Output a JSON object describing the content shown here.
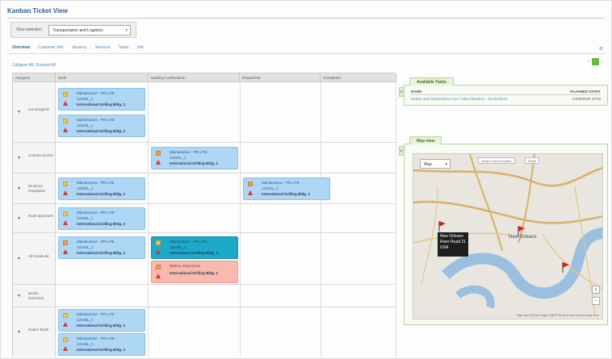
{
  "app": {
    "title": "Kanban Ticket View"
  },
  "view_selector": {
    "label": "View selection",
    "value": "Transportation and Logistics"
  },
  "tabs": [
    {
      "label": "Overview",
      "active": true
    },
    {
      "label": "Customer Info",
      "active": false
    },
    {
      "label": "Vacancy",
      "active": false
    },
    {
      "label": "Services",
      "active": false
    },
    {
      "label": "Tasks",
      "active": false
    },
    {
      "label": "Info",
      "active": false
    }
  ],
  "collapse_link": "Collapse All | Expand All",
  "columns": [
    "Assignee",
    "Work",
    "Awaiting Confirmation",
    "Dispatched",
    "Completed"
  ],
  "rows": [
    {
      "label": "not assigned"
    },
    {
      "label": "Corinna Hinrich"
    },
    {
      "label": "Dimitrios Papadakis"
    },
    {
      "label": "Noah Baumann"
    },
    {
      "label": "Ali Karabulut"
    },
    {
      "label": "Benito Dazzardo"
    },
    {
      "label": "Ruben Barth"
    }
  ],
  "card_text": {
    "line1": "Maintenance - PR LITE",
    "line2": "1234SL_1",
    "line3": "International Drilling Bldg. 2"
  },
  "pink_card": {
    "line1": "Battery Inspections",
    "line3": "International Drilling Bldg. 2"
  },
  "available_tasks": {
    "tab": "Available Tasks",
    "header_name": "NAME",
    "header_start": "PLANNED START",
    "row_name": "Repair and maintenance tour / Atlas Elevators - 04.05.08.02",
    "row_start": "04/05/2018 10:00"
  },
  "map": {
    "tab": "Map view",
    "type": "Map",
    "btn1": "Reset current marker",
    "btn2": "Reset",
    "tooltip": [
      "New Orleans",
      "River Road 21",
      "USA"
    ],
    "place": "New Orleans",
    "footer": "Map data ©2018 Google, INEGI   Terms of Use   Report a map error",
    "zoom_in": "+",
    "zoom_out": "−"
  },
  "colors": {
    "card_blue": "#aed6f5",
    "card_teal": "#1fa9c8",
    "card_pink": "#f8b9af",
    "accent": "#2d5f93",
    "panel_green": "#b8d39d"
  }
}
